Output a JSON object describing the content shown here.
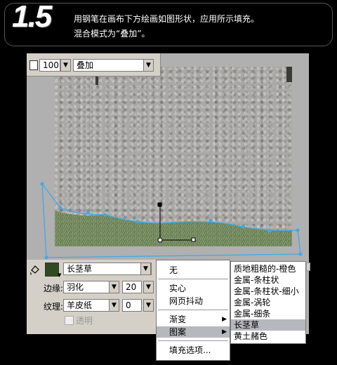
{
  "header": {
    "step": "1.5",
    "instruction_line1": "用钢笔在画布下方绘画如图形状，应用所示填充。",
    "instruction_line2": "混合模式为“叠加”。"
  },
  "top_bar": {
    "opacity_value": "100",
    "blend_mode": "叠加"
  },
  "fill_panel": {
    "fill_type": "长茎草",
    "edge_label": "边缘:",
    "edge_value": "羽化",
    "edge_amount": "20",
    "texture_label": "纹理:",
    "texture_value": "羊皮纸",
    "texture_amount": "0",
    "transparent_label": "透明"
  },
  "fill_menu": {
    "items": [
      "无",
      "实心",
      "网页抖动",
      "渐变",
      "图案",
      "填充选项..."
    ],
    "selected": "图案"
  },
  "pattern_submenu": {
    "items": [
      "质地粗糙的-橙色",
      "金属-条柱状",
      "金属-条柱状-细小",
      "金属-涡轮",
      "金属-细条",
      "长茎草",
      "黄土赭色"
    ],
    "selected": "长茎草"
  },
  "colors": {
    "path_stroke": "#3ea9e6",
    "menu_highlight": "#b7b7be",
    "grass": "#5f7a48"
  }
}
